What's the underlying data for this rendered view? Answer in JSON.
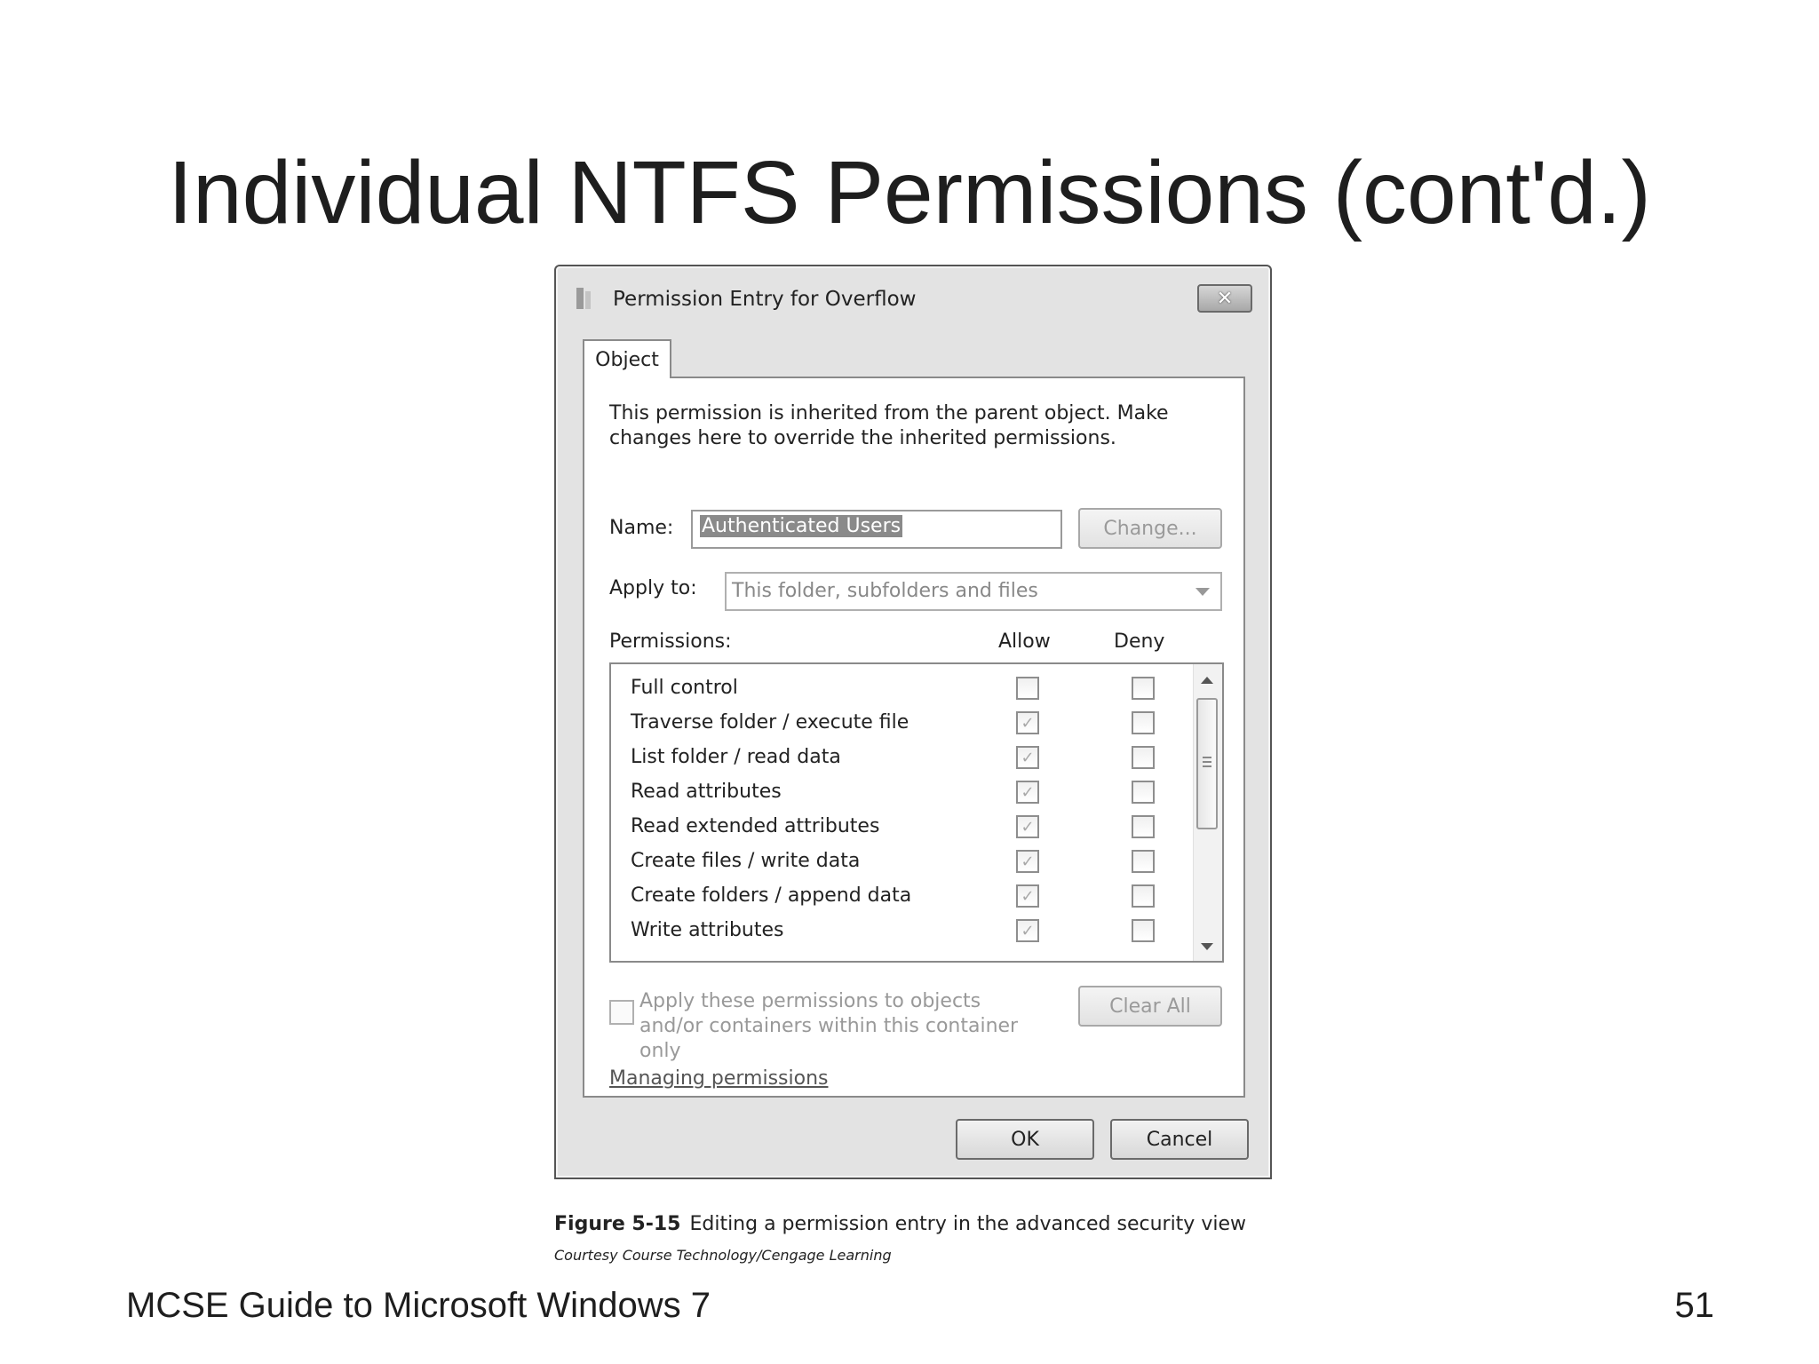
{
  "slide": {
    "title": "Individual NTFS Permissions (cont'd.)",
    "footer_left": "MCSE Guide to Microsoft Windows 7",
    "page_number": "51"
  },
  "dialog": {
    "title": "Permission Entry for Overflow",
    "close_symbol": "✕",
    "tab_label": "Object",
    "info_text": "This permission is inherited from the parent object. Make changes here to override the inherited permissions.",
    "name_label": "Name:",
    "name_value": "Authenticated Users",
    "change_button": "Change...",
    "apply_to_label": "Apply to:",
    "apply_to_value": "This folder, subfolders and files",
    "permissions_label": "Permissions:",
    "allow_header": "Allow",
    "deny_header": "Deny",
    "permissions": [
      {
        "name": "Full control",
        "allow": false,
        "deny": false
      },
      {
        "name": "Traverse folder / execute file",
        "allow": true,
        "deny": false
      },
      {
        "name": "List folder / read data",
        "allow": true,
        "deny": false
      },
      {
        "name": "Read attributes",
        "allow": true,
        "deny": false
      },
      {
        "name": "Read extended attributes",
        "allow": true,
        "deny": false
      },
      {
        "name": "Create files / write data",
        "allow": true,
        "deny": false
      },
      {
        "name": "Create folders / append data",
        "allow": true,
        "deny": false
      },
      {
        "name": "Write attributes",
        "allow": true,
        "deny": false
      }
    ],
    "apply_checkbox_text": "Apply these permissions to objects and/or containers within this container only",
    "clear_all_button": "Clear All",
    "managing_link": "Managing permissions",
    "ok_button": "OK",
    "cancel_button": "Cancel"
  },
  "figure": {
    "label": "Figure 5-15",
    "caption": "Editing a permission entry in the advanced security view",
    "credit": "Courtesy Course Technology/Cengage Learning"
  }
}
